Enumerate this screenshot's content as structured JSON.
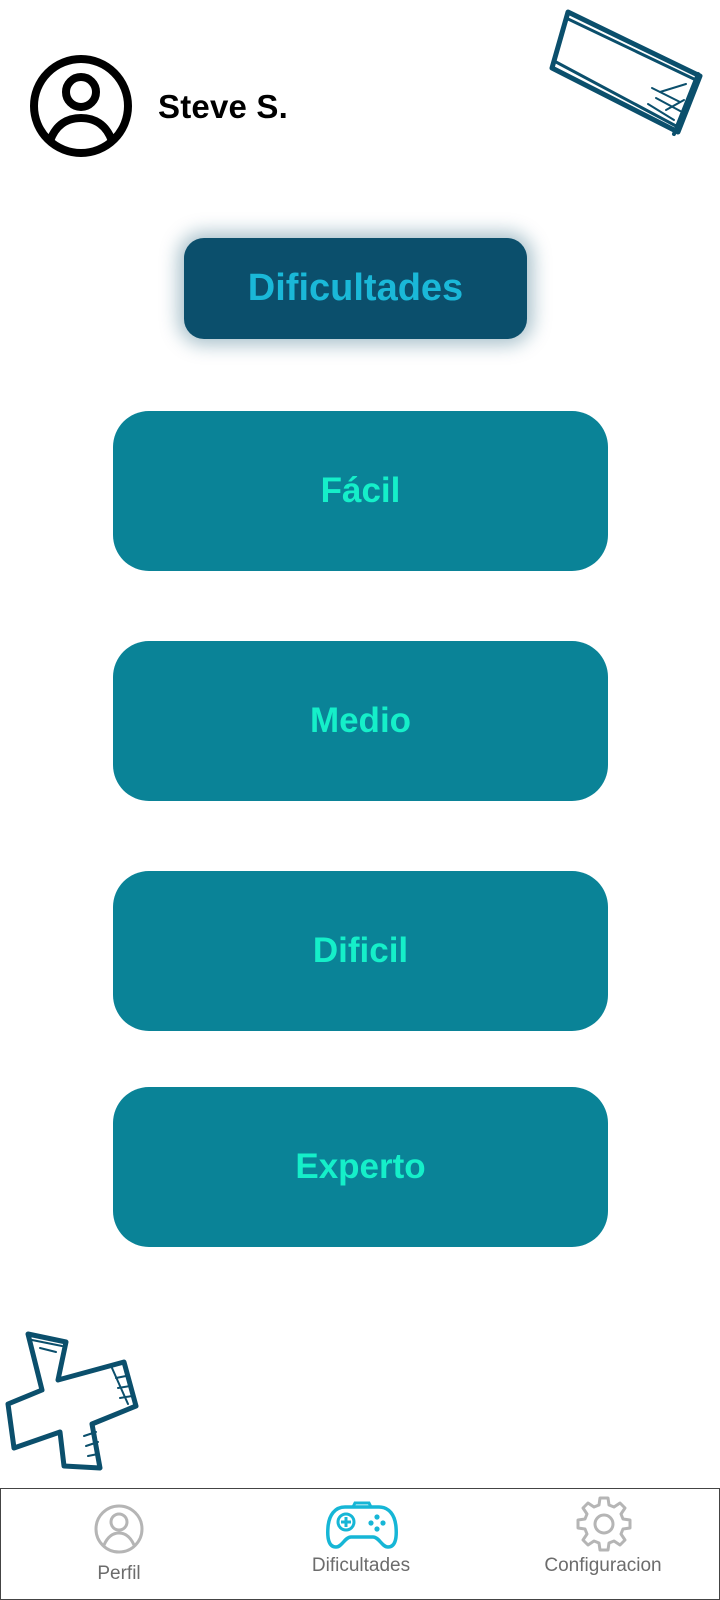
{
  "header": {
    "username": "Steve S.",
    "avatar_icon": "user-circle-icon"
  },
  "title": {
    "label": "Dificultades"
  },
  "levels": [
    {
      "label": "Fácil"
    },
    {
      "label": "Medio"
    },
    {
      "label": "Dificil"
    },
    {
      "label": "Experto"
    }
  ],
  "decorations": {
    "top_right": "sketch-rectangle-icon",
    "bottom_left": "sketch-cross-icon"
  },
  "bottom_nav": {
    "items": [
      {
        "label": "Perfil",
        "icon": "user-circle-icon",
        "active": false
      },
      {
        "label": "Dificultades",
        "icon": "gamepad-icon",
        "active": true
      },
      {
        "label": "Configuracion",
        "icon": "gear-icon",
        "active": false
      }
    ]
  },
  "colors": {
    "title_bg": "#0b4f6c",
    "title_text": "#1ab8d8",
    "button_bg": "#0a8397",
    "button_text": "#15efc9",
    "decoration": "#0b4f6c",
    "nav_active": "#16b6d6",
    "nav_inactive": "#b5b5b5"
  }
}
